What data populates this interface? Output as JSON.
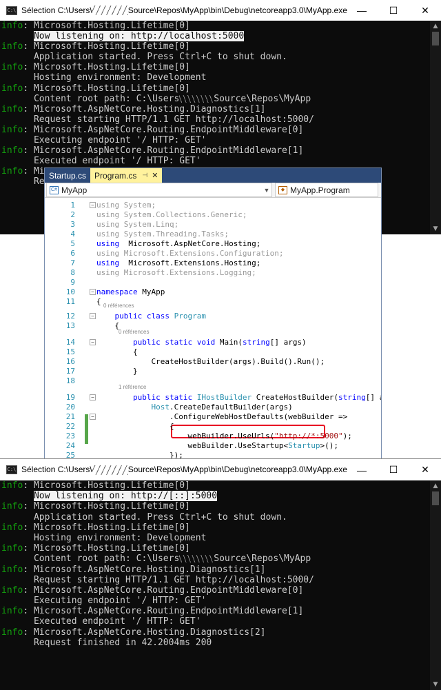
{
  "top_console": {
    "title_prefix": "Sélection C:\\Users\\",
    "title_suffix": "Source\\Repos\\MyApp\\bin\\Debug\\netcoreapp3.0\\MyApp.exe",
    "lines": [
      {
        "tag": "info",
        "text": ": Microsoft.Hosting.Lifetime[0]"
      },
      {
        "tag": "",
        "indent": "      ",
        "hl": "Now listening on: http://localhost:5000"
      },
      {
        "tag": "info",
        "text": ": Microsoft.Hosting.Lifetime[0]"
      },
      {
        "tag": "",
        "text": "      Application started. Press Ctrl+C to shut down."
      },
      {
        "tag": "info",
        "text": ": Microsoft.Hosting.Lifetime[0]"
      },
      {
        "tag": "",
        "text": "      Hosting environment: Development"
      },
      {
        "tag": "info",
        "text": ": Microsoft.Hosting.Lifetime[0]"
      },
      {
        "tag": "",
        "text": "      Content root path: C:\\Users",
        "redacted": true,
        "text2": "Source\\Repos\\MyApp"
      },
      {
        "tag": "info",
        "text": ": Microsoft.AspNetCore.Hosting.Diagnostics[1]"
      },
      {
        "tag": "",
        "text": "      Request starting HTTP/1.1 GET http://localhost:5000/"
      },
      {
        "tag": "info",
        "text": ": Microsoft.AspNetCore.Routing.EndpointMiddleware[0]"
      },
      {
        "tag": "",
        "text": "      Executing endpoint '/ HTTP: GET'"
      },
      {
        "tag": "info",
        "text": ": Microsoft.AspNetCore.Routing.EndpointMiddleware[1]"
      },
      {
        "tag": "",
        "text": "      Executed endpoint '/ HTTP: GET'"
      },
      {
        "tag": "info",
        "text": ": Mi"
      },
      {
        "tag": "",
        "text": "      Re"
      }
    ]
  },
  "bottom_console": {
    "title_prefix": "Sélection C:\\Users\\",
    "title_suffix": "Source\\Repos\\MyApp\\bin\\Debug\\netcoreapp3.0\\MyApp.exe",
    "lines": [
      {
        "tag": "info",
        "text": ": Microsoft.Hosting.Lifetime[0]"
      },
      {
        "tag": "",
        "indent": "      ",
        "hl": "Now listening on: http://[::]:5000"
      },
      {
        "tag": "info",
        "text": ": Microsoft.Hosting.Lifetime[0]"
      },
      {
        "tag": "",
        "text": "      Application started. Press Ctrl+C to shut down."
      },
      {
        "tag": "info",
        "text": ": Microsoft.Hosting.Lifetime[0]"
      },
      {
        "tag": "",
        "text": "      Hosting environment: Development"
      },
      {
        "tag": "info",
        "text": ": Microsoft.Hosting.Lifetime[0]"
      },
      {
        "tag": "",
        "text": "      Content root path: C:\\Users",
        "redacted": true,
        "text2": "Source\\Repos\\MyApp"
      },
      {
        "tag": "info",
        "text": ": Microsoft.AspNetCore.Hosting.Diagnostics[1]"
      },
      {
        "tag": "",
        "text": "      Request starting HTTP/1.1 GET http://localhost:5000/"
      },
      {
        "tag": "info",
        "text": ": Microsoft.AspNetCore.Routing.EndpointMiddleware[0]"
      },
      {
        "tag": "",
        "text": "      Executing endpoint '/ HTTP: GET'"
      },
      {
        "tag": "info",
        "text": ": Microsoft.AspNetCore.Routing.EndpointMiddleware[1]"
      },
      {
        "tag": "",
        "text": "      Executed endpoint '/ HTTP: GET'"
      },
      {
        "tag": "info",
        "text": ": Microsoft.AspNetCore.Hosting.Diagnostics[2]"
      },
      {
        "tag": "",
        "text": "      Request finished in 42.2004ms 200"
      }
    ]
  },
  "console_info_tag": "info",
  "window_buttons": {
    "minimize": "—",
    "maximize": "☐",
    "close": "✕"
  },
  "editor": {
    "tabs": [
      {
        "label": "Startup.cs",
        "active": false
      },
      {
        "label": "Program.cs",
        "active": true,
        "pin": "⊣",
        "close": "✕"
      }
    ],
    "nav_left": "MyApp",
    "nav_right": "MyApp.Program",
    "code_lens": [
      "0 références",
      "0 références",
      "1 référence"
    ],
    "lines": [
      {
        "n": "1",
        "fold": "−",
        "parts": [
          [
            "dim",
            "using System;"
          ]
        ]
      },
      {
        "n": "2",
        "parts": [
          [
            "dim",
            "using System.Collections.Generic;"
          ]
        ]
      },
      {
        "n": "3",
        "parts": [
          [
            "dim",
            "using System.Linq;"
          ]
        ]
      },
      {
        "n": "4",
        "parts": [
          [
            "dim",
            "using System.Threading.Tasks;"
          ]
        ]
      },
      {
        "n": "5",
        "parts": [
          [
            "kw",
            "using"
          ],
          [
            "",
            "  Microsoft.AspNetCore.Hosting;"
          ]
        ]
      },
      {
        "n": "6",
        "parts": [
          [
            "dim",
            "using Microsoft.Extensions.Configuration;"
          ]
        ]
      },
      {
        "n": "7",
        "parts": [
          [
            "kw",
            "using"
          ],
          [
            "",
            "  Microsoft.Extensions.Hosting;"
          ]
        ]
      },
      {
        "n": "8",
        "parts": [
          [
            "dim",
            "using Microsoft.Extensions.Logging;"
          ]
        ]
      },
      {
        "n": "9",
        "parts": []
      },
      {
        "n": "10",
        "fold": "−",
        "parts": [
          [
            "kw",
            "namespace"
          ],
          [
            "",
            " MyApp"
          ]
        ]
      },
      {
        "n": "11",
        "parts": [
          [
            "",
            "{"
          ]
        ]
      },
      {
        "n": "12",
        "fold": "−",
        "parts": [
          [
            "",
            "    "
          ],
          [
            "kw",
            "public class"
          ],
          [
            "",
            " "
          ],
          [
            "ty",
            "Program"
          ]
        ]
      },
      {
        "n": "13",
        "parts": [
          [
            "",
            "    {"
          ]
        ]
      },
      {
        "n": "14",
        "fold": "−",
        "parts": [
          [
            "",
            "        "
          ],
          [
            "kw",
            "public static void"
          ],
          [
            "",
            " Main("
          ],
          [
            "kw",
            "string"
          ],
          [
            "",
            "[] args)"
          ]
        ]
      },
      {
        "n": "15",
        "parts": [
          [
            "",
            "        {"
          ]
        ]
      },
      {
        "n": "16",
        "parts": [
          [
            "",
            "            CreateHostBuilder(args).Build().Run();"
          ]
        ]
      },
      {
        "n": "17",
        "parts": [
          [
            "",
            "        }"
          ]
        ]
      },
      {
        "n": "18",
        "parts": []
      },
      {
        "n": "19",
        "fold": "−",
        "parts": [
          [
            "",
            "        "
          ],
          [
            "kw",
            "public static"
          ],
          [
            "",
            " "
          ],
          [
            "ty",
            "IHostBuilder"
          ],
          [
            "",
            " CreateHostBuilder("
          ],
          [
            "kw",
            "string"
          ],
          [
            "",
            "[] args) =>"
          ]
        ]
      },
      {
        "n": "20",
        "parts": [
          [
            "",
            "            "
          ],
          [
            "ty",
            "Host"
          ],
          [
            "",
            ".CreateDefaultBuilder(args)"
          ]
        ]
      },
      {
        "n": "21",
        "fold": "−",
        "parts": [
          [
            "",
            "                .ConfigureWebHostDefaults(webBuilder =>"
          ]
        ]
      },
      {
        "n": "22",
        "parts": [
          [
            "",
            "                {"
          ]
        ]
      },
      {
        "n": "23",
        "parts": [
          [
            "",
            "                    webBuilder.UseUrls("
          ],
          [
            "st",
            "\"http://*:5000\""
          ],
          [
            "",
            ");"
          ]
        ]
      },
      {
        "n": "24",
        "parts": [
          [
            "",
            "                    webBuilder.UseStartup<"
          ],
          [
            "ty",
            "Startup"
          ],
          [
            "",
            ">();"
          ]
        ]
      },
      {
        "n": "25",
        "parts": [
          [
            "",
            "                });"
          ]
        ]
      },
      {
        "n": "",
        "parts": [
          [
            "",
            "        }"
          ]
        ]
      }
    ]
  }
}
